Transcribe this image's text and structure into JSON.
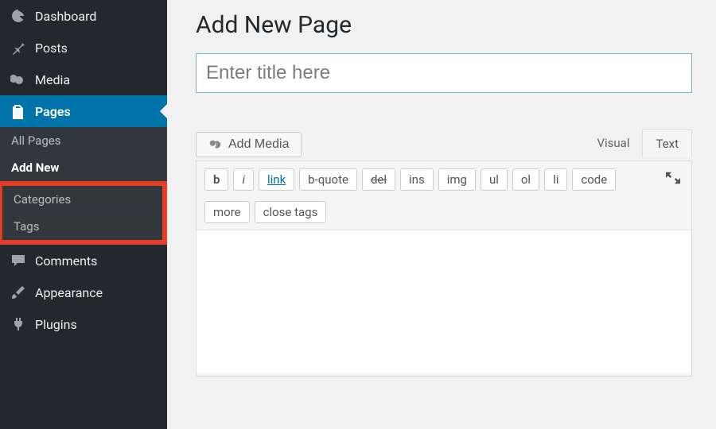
{
  "sidebar": {
    "items": [
      {
        "label": "Dashboard"
      },
      {
        "label": "Posts"
      },
      {
        "label": "Media"
      },
      {
        "label": "Pages"
      },
      {
        "label": "Comments"
      },
      {
        "label": "Appearance"
      },
      {
        "label": "Plugins"
      }
    ],
    "pages_submenu": [
      {
        "label": "All Pages"
      },
      {
        "label": "Add New"
      },
      {
        "label": "Categories"
      },
      {
        "label": "Tags"
      }
    ]
  },
  "page": {
    "heading": "Add New Page",
    "title_placeholder": "Enter title here"
  },
  "editor": {
    "add_media_label": "Add Media",
    "tabs": {
      "visual": "Visual",
      "text": "Text"
    },
    "quicktags": {
      "b": "b",
      "i": "i",
      "link": "link",
      "bquote": "b-quote",
      "del": "del",
      "ins": "ins",
      "img": "img",
      "ul": "ul",
      "ol": "ol",
      "li": "li",
      "code": "code",
      "more": "more",
      "close": "close tags"
    }
  }
}
